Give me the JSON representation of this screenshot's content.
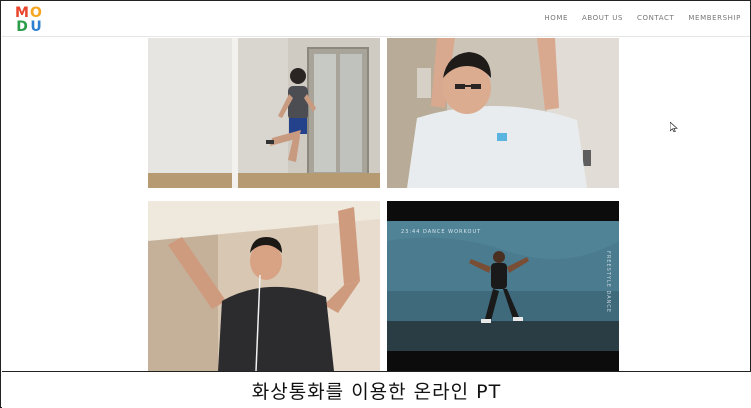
{
  "header": {
    "logo": {
      "letters": [
        "M",
        "O",
        "D",
        "U"
      ],
      "colors": [
        "#e8452c",
        "#f5a623",
        "#2e9d4a",
        "#2f7fd0"
      ]
    },
    "nav": [
      {
        "label": "HOME"
      },
      {
        "label": "ABOUT US"
      },
      {
        "label": "CONTACT"
      },
      {
        "label": "MEMBERSHIP"
      }
    ]
  },
  "video_grid": {
    "tiles": [
      {
        "name": "participant-1"
      },
      {
        "name": "participant-2"
      },
      {
        "name": "participant-3"
      },
      {
        "name": "dance-workout-video",
        "overlay_text": "23:44  DANCE WORKOUT",
        "side_text": "FREESTYLE DANCE"
      }
    ]
  },
  "caption": "화상통화를 이용한 온라인 PT",
  "colors": {
    "border": "#222222",
    "nav_text": "#777777",
    "video_bg": "#0c0c0c"
  }
}
